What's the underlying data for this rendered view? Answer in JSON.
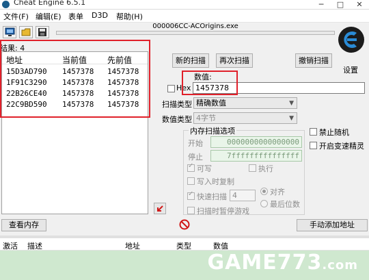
{
  "window": {
    "title": "Cheat Engine 6.5.1",
    "minimize": "─",
    "maximize": "□",
    "close": "✕"
  },
  "menu": [
    {
      "label": "文件(F)"
    },
    {
      "label": "编辑(E)"
    },
    {
      "label": "表单"
    },
    {
      "label": "D3D"
    },
    {
      "label": "帮助(H)"
    }
  ],
  "toolbar": {
    "icons": [
      "select-process-icon",
      "open-icon",
      "save-icon"
    ]
  },
  "process": {
    "name": "000006CC-ACOrigins.exe"
  },
  "results": {
    "label": "结果: 4",
    "columns": [
      "地址",
      "当前值",
      "先前值"
    ],
    "rows": [
      {
        "address": "15D3AD790",
        "current": "1457378",
        "previous": "1457378"
      },
      {
        "address": "1F91C3290",
        "current": "1457378",
        "previous": "1457378"
      },
      {
        "address": "22B26CE40",
        "current": "1457378",
        "previous": "1457378"
      },
      {
        "address": "22C9BD590",
        "current": "1457378",
        "previous": "1457378"
      }
    ]
  },
  "scan": {
    "new_scan": "新的扫描",
    "next_scan": "再次扫描",
    "undo_scan": "撤销扫描",
    "settings": "设置",
    "value_label": "数值:",
    "hex_label": "Hex",
    "value": "1457378",
    "scan_type_label": "扫描类型",
    "scan_type": "精确数值",
    "value_type_label": "数值类型",
    "value_type": "4字节",
    "memory_options_label": "内存扫描选项",
    "start_label": "开始",
    "start_value": "0000000000000000",
    "stop_label": "停止",
    "stop_value": "7fffffffffffffff",
    "writable": "可写",
    "executable": "执行",
    "copy_on_write": "写入时复制",
    "fast_scan": "快速扫描",
    "fast_scan_value": "4",
    "align": "对齐",
    "last_digits": "最后位数",
    "pause_game": "扫描时暂停游戏",
    "disable_random": "禁止随机",
    "enable_speedhack": "开启变速精灵"
  },
  "bottom": {
    "view_memory": "查看内存",
    "add_address": "手动添加地址",
    "columns": [
      "激活",
      "描述",
      "地址",
      "类型",
      "数值"
    ]
  },
  "watermark": {
    "brand": "GAME773",
    "suffix": ".com"
  },
  "colors": {
    "highlight": "#e0202a",
    "table_area": "#cfe8cf"
  }
}
